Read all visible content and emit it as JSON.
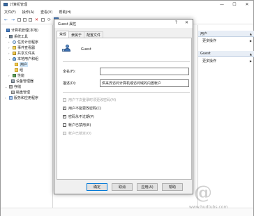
{
  "window": {
    "title": "计算机管理",
    "minimize": "—",
    "maximize": "☐",
    "close": "✕"
  },
  "menu": [
    "文件(F)",
    "操作(A)",
    "查看(V)",
    "帮助(H)"
  ],
  "tree": {
    "root": "计算机管理(本地)",
    "system_tools": "系统工具",
    "task_scheduler": "任务计划程序",
    "event_viewer": "事件查看器",
    "shared_folders": "共享文件夹",
    "local_users": "本地用户和组",
    "users": "用户",
    "groups": "组",
    "performance": "性能",
    "device_manager": "设备管理器",
    "storage": "存储",
    "disk_management": "磁盘管理",
    "services": "服务和应用程序"
  },
  "actions": {
    "header1": "用户",
    "more1": "更多操作",
    "header2": "Guest",
    "more2": "更多操作"
  },
  "dialog": {
    "title": "Guest 属性",
    "help": "?",
    "close": "✕",
    "tabs": [
      "常规",
      "隶属于",
      "配置文件"
    ],
    "active_tab": "常规",
    "username": "Guest",
    "fullname_label": "全名(F):",
    "fullname_value": "",
    "description_label": "描述(D):",
    "description_value": "供来宾访问计算机或访问域的内置帐户",
    "checkboxes": [
      {
        "label": "用户下次登录时须更改密码(M)",
        "checked": false,
        "disabled": true
      },
      {
        "label": "用户不能更改密码(C)",
        "checked": true,
        "disabled": false
      },
      {
        "label": "密码永不过期(P)",
        "checked": true,
        "disabled": false
      },
      {
        "label": "帐户已禁用(B)",
        "checked": false,
        "disabled": false
      },
      {
        "label": "帐户已锁定(O)",
        "checked": false,
        "disabled": true
      }
    ],
    "buttons": {
      "ok": "确定",
      "cancel": "取消",
      "apply": "应用(A)",
      "help": "帮助"
    }
  },
  "watermark": {
    "glyph": "@",
    "url": "www.hudtubs.com"
  }
}
